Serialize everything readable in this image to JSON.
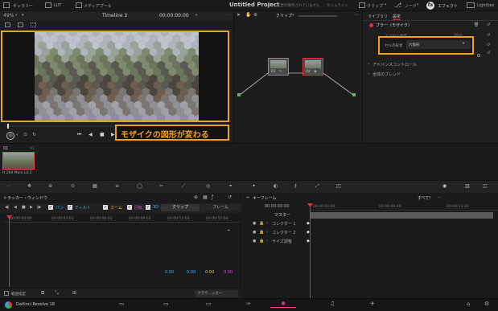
{
  "top_menu": {
    "gallery": "ギャラリー",
    "lut": "LUT",
    "media_pool": "メディアプール",
    "project_title": "Untitled Project",
    "save_status": "変更が保存されていません",
    "timeline": "タイムライン",
    "clips": "クリップ",
    "nodes": "ノード",
    "effects": "エフェクト",
    "lightbox": "Lightbox"
  },
  "viewer": {
    "zoom": "49%",
    "timeline_name": "Timeline 1",
    "timecode": "00:00:00:00",
    "caption": "モザイクの図形が変わる"
  },
  "node_editor": {
    "dropdown": "クリップ",
    "node1_label": "01",
    "node2_label": "02"
  },
  "inspector": {
    "tab_library": "ライブラリ",
    "tab_settings": "設定",
    "effect_name": "ブラー（モザイク）",
    "hidden_row_label": "ピクセル頻度",
    "hidden_row_value": "30.0",
    "cell_shape_label": "セルの形状",
    "cell_shape_value": "六角形",
    "advanced_controls": "アドバンスコントロール",
    "global_blend": "全体のブレンド"
  },
  "clip_strip": {
    "clip_number": "01",
    "track": "V1",
    "codec": "H.264 Main L4.2"
  },
  "tracker": {
    "title": "トラッカー・ウィンドウ",
    "checks": [
      {
        "label": "パン",
        "color": "#3bb0e8"
      },
      {
        "label": "ティルト",
        "color": "#3bb0e8"
      },
      {
        "label": "ズーム",
        "color": "#e8c43b"
      },
      {
        "label": "回転",
        "color": "#d04fd0"
      },
      {
        "label": "3D",
        "color": "#3bb0e8"
      }
    ],
    "mode_clip": "クリップ",
    "mode_frame": "フレーム",
    "ruler": [
      "00:00:00:00",
      "00:00:03:01",
      "00:00:06:01",
      "00:00:09:02",
      "00:00:12:03",
      "00:00:15:04"
    ],
    "values": [
      {
        "text": "0.00",
        "color": "#3bb0e8"
      },
      {
        "text": "0.00",
        "color": "#3bb0e8"
      },
      {
        "text": "0.00",
        "color": "#e8c43b"
      },
      {
        "text": "0.00",
        "color": "#d04fd0"
      }
    ],
    "footer_label": "範囲指定",
    "footer_dropdown": "クラウ...ッカー"
  },
  "keyframes": {
    "title": "キーフレーム",
    "filter": "すべて",
    "timecode": "00:00:00:00",
    "ruler": [
      "00:00:00:00",
      "00:00:06:40",
      "00:00:13:20"
    ],
    "tracks": [
      "マスター",
      "コレクター 1",
      "コレクター 2",
      "サイズ調整"
    ]
  },
  "bottom_bar": {
    "app_name": "DaVinci Resolve 18"
  }
}
